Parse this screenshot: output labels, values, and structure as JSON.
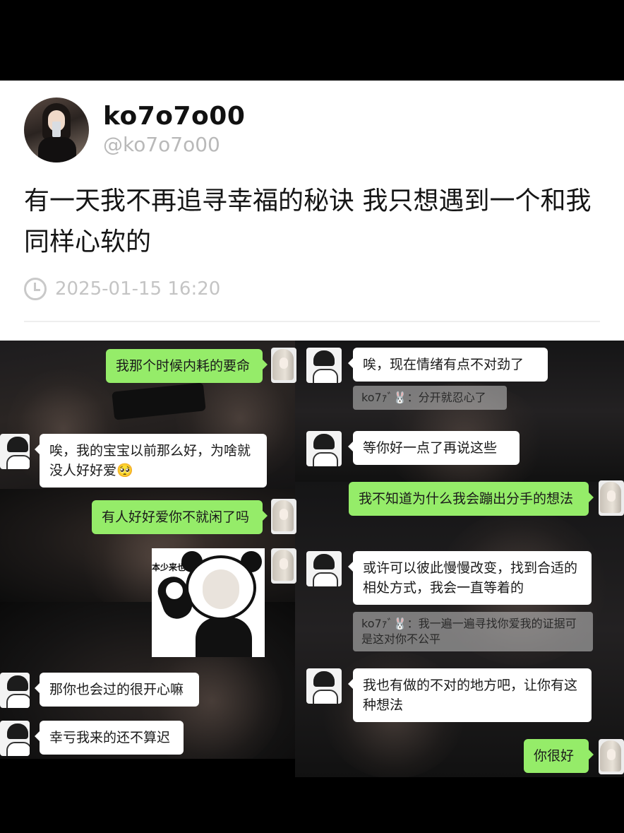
{
  "post": {
    "display_name": "ko7o7o00",
    "handle": "@ko7o7o00",
    "text": "有一天我不再追寻幸福的秘诀 我只想遇到一个和我同样心软的",
    "timestamp": "2025-01-15 16:20"
  },
  "chat_left": {
    "messages": [
      {
        "side": "right",
        "text": "我那个时候内耗的要命"
      },
      {
        "side": "left",
        "text": "唉，我的宝宝以前那么好，为啥就没人好好爱🥺"
      },
      {
        "side": "right",
        "text": "有人好好爱你不就闲了吗"
      },
      {
        "side": "right",
        "sticker_text": "本少来也"
      },
      {
        "side": "left",
        "text": "那你也会过的很开心嘛"
      },
      {
        "side": "left",
        "text": "幸亏我来的还不算迟"
      }
    ]
  },
  "chat_right": {
    "messages": [
      {
        "side": "left",
        "text": "唉，现在情绪有点不对劲了"
      },
      {
        "type": "quote",
        "text": "ko7ｧﾞ🐰：分开就忍心了"
      },
      {
        "side": "left",
        "text": "等你好一点了再说这些"
      },
      {
        "side": "right",
        "text": "我不知道为什么我会蹦出分手的想法"
      },
      {
        "side": "left",
        "text": "或许可以彼此慢慢改变，找到合适的相处方式，我会一直等着的"
      },
      {
        "type": "quote",
        "text": "ko7ｧﾞ🐰：我一遍一遍寻找你爱我的证据可是这对你不公平"
      },
      {
        "side": "left",
        "text": "我也有做的不对的地方吧，让你有这种想法"
      },
      {
        "side": "right",
        "text": "你很好"
      }
    ]
  },
  "colors": {
    "green_bubble": "#95ec69",
    "white_bubble": "#ffffff",
    "handle_gray": "#b9b9b9"
  }
}
